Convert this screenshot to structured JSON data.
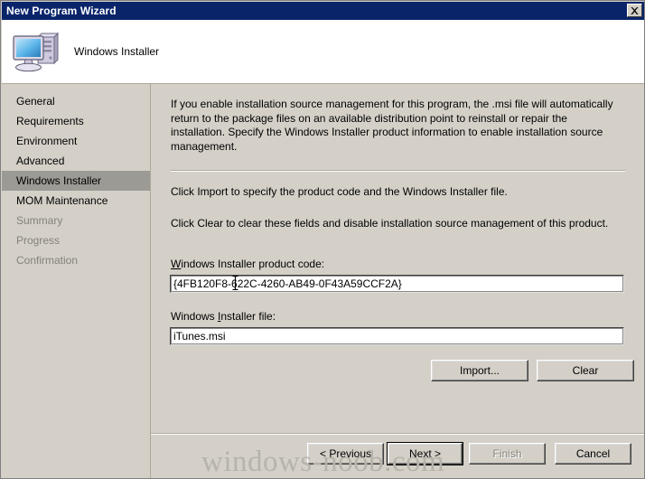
{
  "window": {
    "title": "New Program Wizard",
    "close_label": "X"
  },
  "header": {
    "title": "Windows Installer",
    "icon": "computer-icon"
  },
  "sidebar": {
    "items": [
      {
        "label": "General",
        "state": "normal"
      },
      {
        "label": "Requirements",
        "state": "normal"
      },
      {
        "label": "Environment",
        "state": "normal"
      },
      {
        "label": "Advanced",
        "state": "normal"
      },
      {
        "label": "Windows Installer",
        "state": "selected"
      },
      {
        "label": "MOM Maintenance",
        "state": "normal"
      },
      {
        "label": "Summary",
        "state": "disabled"
      },
      {
        "label": "Progress",
        "state": "disabled"
      },
      {
        "label": "Confirmation",
        "state": "disabled"
      }
    ]
  },
  "content": {
    "intro": "If you enable installation source management for this program, the .msi file will automatically return to the package files on an available distribution point to reinstall or repair the installation. Specify the Windows Installer product information to enable installation source management.",
    "import_hint": "Click Import to specify the product code and the Windows Installer file.",
    "clear_hint": "Click Clear to clear these fields and disable installation source management of this product.",
    "product_code_label": "Windows Installer product code:",
    "product_code_value": "{4FB120F8-622C-4260-AB49-0F43A59CCF2A}",
    "installer_file_label": "Windows Installer file:",
    "installer_file_value": "iTunes.msi",
    "import_button": "Import...",
    "clear_button": "Clear"
  },
  "footer": {
    "previous": "< Previous",
    "next": "Next >",
    "finish": "Finish",
    "cancel": "Cancel"
  },
  "watermark": {
    "text": "windows-noob.com"
  },
  "colors": {
    "titlebar": "#0a246a",
    "dialog_face": "#d4d0c8",
    "selection": "#9b9a94",
    "disabled_text": "#848278",
    "field_background": "#ffffff"
  }
}
